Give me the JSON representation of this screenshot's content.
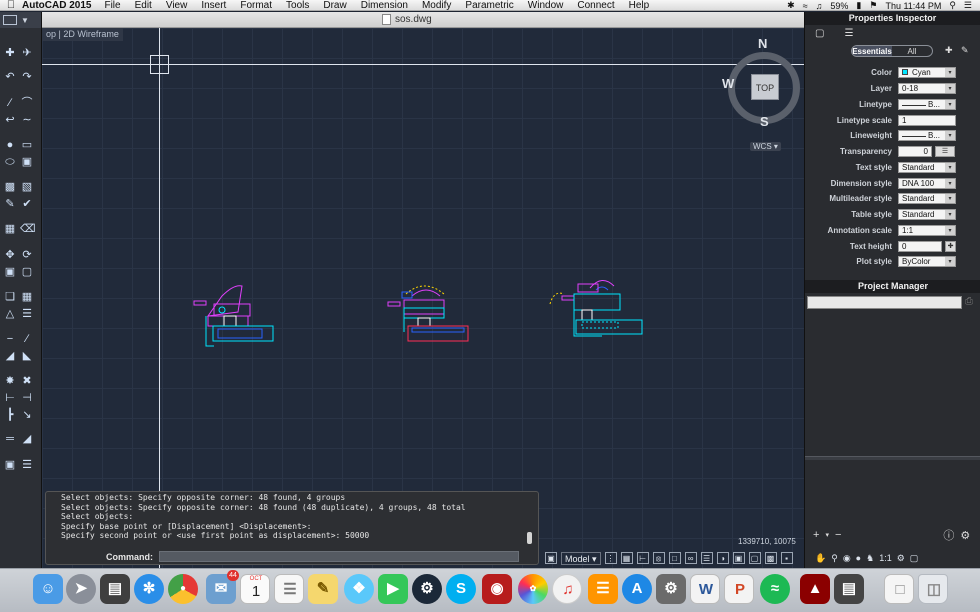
{
  "menubar": {
    "app_name": "AutoCAD 2015",
    "items": [
      "File",
      "Edit",
      "View",
      "Insert",
      "Format",
      "Tools",
      "Draw",
      "Dimension",
      "Modify",
      "Parametric",
      "Window",
      "Connect",
      "Help"
    ],
    "battery": "59%",
    "clock": "Thu 11:44 PM"
  },
  "window": {
    "title": "sos.dwg"
  },
  "viewport": {
    "label": "op | 2D Wireframe",
    "viewcube": {
      "n": "N",
      "s": "S",
      "w": "W",
      "face": "TOP"
    },
    "wcs": "WCS",
    "coords": "1339710, 10075"
  },
  "command_line": {
    "history": [
      "Select objects: Specify opposite corner: 48 found, 4 groups",
      "Select objects: Specify opposite corner: 48 found (48 duplicate), 4 groups, 48 total",
      "Select objects:",
      "Specify base point or [Displacement] <Displacement>:",
      "Specify second point or <use first point as displacement>: 50000"
    ],
    "prompt_label": "Command:"
  },
  "status_bar": {
    "model_label": "Model",
    "scale": "1:1"
  },
  "properties_inspector": {
    "title": "Properties Inspector",
    "tabs": [
      "Essentials",
      "All"
    ],
    "rows": [
      {
        "label": "Color",
        "value": "Cyan"
      },
      {
        "label": "Layer",
        "value": "0-18"
      },
      {
        "label": "Linetype",
        "value": "B..."
      },
      {
        "label": "Linetype scale",
        "value": "1"
      },
      {
        "label": "Lineweight",
        "value": "B..."
      },
      {
        "label": "Transparency",
        "value": "0"
      },
      {
        "label": "Text style",
        "value": "Standard"
      },
      {
        "label": "Dimension style",
        "value": "DNA 100"
      },
      {
        "label": "Multileader style",
        "value": "Standard"
      },
      {
        "label": "Table style",
        "value": "Standard"
      },
      {
        "label": "Annotation scale",
        "value": "1:1"
      },
      {
        "label": "Text height",
        "value": "0"
      },
      {
        "label": "Plot style",
        "value": "ByColor"
      }
    ]
  },
  "project_manager": {
    "title": "Project Manager"
  },
  "colors": {
    "cyan": "#00e5ff",
    "magenta": "#e040fb",
    "red": "#ff2d55",
    "blue": "#2962ff",
    "yellow": "#ffd600"
  },
  "dock": {
    "apps": [
      "Finder",
      "Launchpad",
      "Mission Control",
      "Safari",
      "Chrome",
      "Photo Booth",
      "Calendar",
      "Reminders",
      "Notes",
      "Messages",
      "FaceTime",
      "Steam",
      "Skype",
      "Photo Booth",
      "Photos",
      "iTunes",
      "iBooks",
      "App Store",
      "System Preferences",
      "Word",
      "PowerPoint",
      "Spotify",
      "AutoCAD",
      "Preview",
      "Documents",
      "Trash"
    ],
    "calendar_day": "1",
    "calendar_month": "OCT",
    "badge_count": "44"
  }
}
